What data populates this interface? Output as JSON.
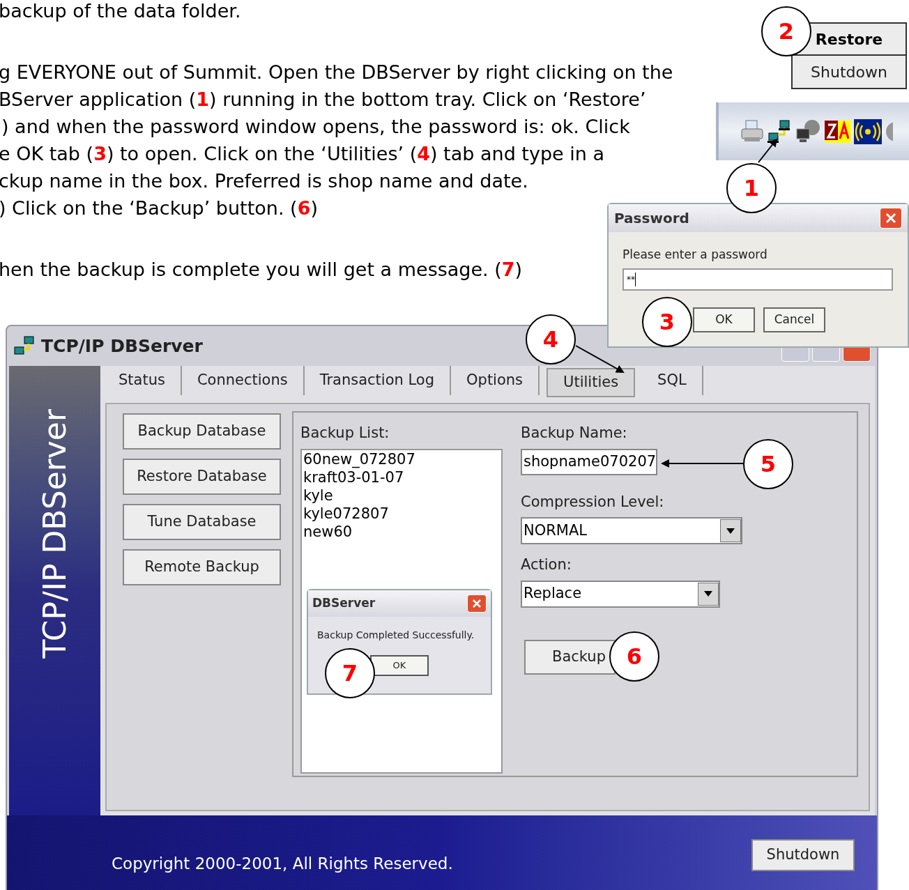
{
  "instructions": [
    {
      "segments": [
        {
          "kind": "plain",
          "text": "backup of the data folder."
        }
      ]
    },
    {
      "segments": [
        {
          "kind": "plain",
          "text": "g EVERYONE out of Summit. Open the DBServer by right clicking on the"
        }
      ]
    },
    {
      "segments": [
        {
          "kind": "plain",
          "text": "BServer application ("
        },
        {
          "kind": "step",
          "text": "1"
        },
        {
          "kind": "plain",
          "text": ") running in the bottom tray. Click on ‘Restore’"
        }
      ]
    },
    {
      "segments": [
        {
          "kind": "plain",
          "text": ") and when the password window opens, the password is: ok. Click"
        }
      ]
    },
    {
      "segments": [
        {
          "kind": "plain",
          "text": "e OK tab ("
        },
        {
          "kind": "step",
          "text": "3"
        },
        {
          "kind": "plain",
          "text": ") to open. Click on the ‘Utilities’ ("
        },
        {
          "kind": "step",
          "text": "4"
        },
        {
          "kind": "plain",
          "text": ") tab and type in a"
        }
      ]
    },
    {
      "segments": [
        {
          "kind": "plain",
          "text": "ckup name in the box. Preferred is shop name and date."
        }
      ]
    },
    {
      "segments": [
        {
          "kind": "plain",
          "text": ") Click on the ‘Backup’ button. ("
        },
        {
          "kind": "step",
          "text": "6"
        },
        {
          "kind": "plain",
          "text": ")"
        }
      ]
    },
    {
      "segments": [
        {
          "kind": "plain",
          "text": "hen the backup is complete you will get a message. ("
        },
        {
          "kind": "step",
          "text": "7"
        },
        {
          "kind": "plain",
          "text": ")"
        }
      ]
    }
  ],
  "tray_menu": {
    "items": [
      {
        "label": "Restore",
        "selected": true
      },
      {
        "label": "Shutdown",
        "selected": false
      }
    ]
  },
  "main_window": {
    "title": "TCP/IP DBServer",
    "side_banner": "TCP/IP DBServer",
    "tabs": [
      {
        "label": "Status",
        "selected": false
      },
      {
        "label": "Connections",
        "selected": false
      },
      {
        "label": "Transaction Log",
        "selected": false
      },
      {
        "label": "Options",
        "selected": false
      },
      {
        "label": "Utilities",
        "selected": true
      },
      {
        "label": "SQL",
        "selected": false
      }
    ],
    "actions": [
      "Backup Database",
      "Restore Database",
      "Tune Database",
      "Remote Backup"
    ],
    "backup_list": {
      "label": "Backup List:",
      "items": [
        "60new_072807",
        "kraft03-01-07",
        "kyle",
        "kyle072807",
        "new60"
      ]
    },
    "backup_name": {
      "label": "Backup Name:",
      "value": "shopname070207"
    },
    "compression": {
      "label": "Compression Level:",
      "value": "NORMAL"
    },
    "action": {
      "label": "Action:",
      "value": "Replace"
    },
    "backup_button": "Backup",
    "copyright": "Copyright 2000-2001, All Rights Reserved.",
    "shutdown_button": "Shutdown"
  },
  "password_dialog": {
    "title": "Password",
    "prompt": "Please enter a password",
    "value": "**",
    "buttons": [
      "OK",
      "Cancel"
    ]
  },
  "message_box": {
    "title": "DBServer",
    "message": "Backup Completed Successfully.",
    "button": "OK"
  },
  "callouts": [
    {
      "label": "1"
    },
    {
      "label": "2"
    },
    {
      "label": "3"
    },
    {
      "label": "4"
    },
    {
      "label": "5"
    },
    {
      "label": "6"
    },
    {
      "label": "7"
    }
  ]
}
